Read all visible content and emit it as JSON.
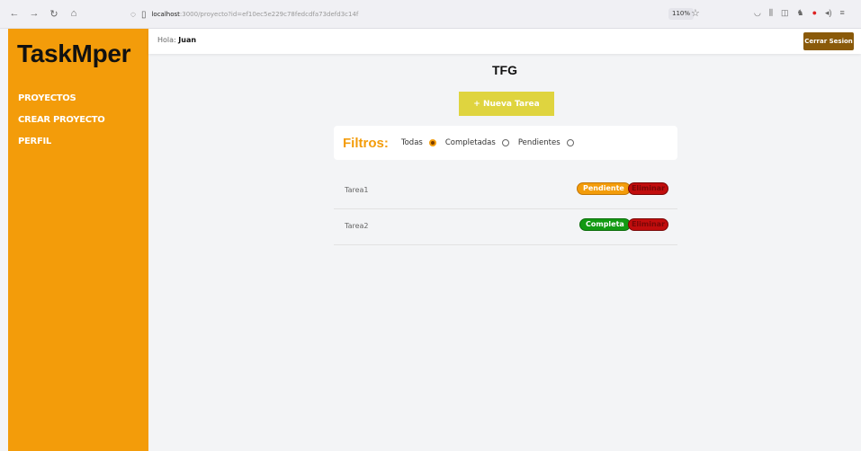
{
  "browser": {
    "url_host": "localhost",
    "url_rest": ":3000/proyecto?id=ef10ec5e229c78fedcdfa73defd3c14f",
    "zoom": "110%"
  },
  "app": {
    "brand": "TaskMper",
    "greeting_prefix": "Hola:",
    "user_name": "Juan",
    "logout_label": "Cerrar Sesion"
  },
  "sidebar": {
    "items": [
      {
        "label": "PROYECTOS"
      },
      {
        "label": "CREAR PROYECTO"
      },
      {
        "label": "PERFIL"
      }
    ]
  },
  "project": {
    "title": "TFG",
    "new_task_label": "+ Nueva Tarea"
  },
  "filters": {
    "title": "Filtros:",
    "options": [
      {
        "label": "Todas",
        "checked": true
      },
      {
        "label": "Completadas",
        "checked": false
      },
      {
        "label": "Pendientes",
        "checked": false
      }
    ]
  },
  "tasks": [
    {
      "name": "Tarea1",
      "state_label": "Pendiente",
      "delete_label": "Eliminar"
    },
    {
      "name": "Tarea2",
      "state_label": "Completa",
      "delete_label": "Eliminar"
    }
  ],
  "colors": {
    "accent": "#f39c0a",
    "new_task": "#dfd43f",
    "logout": "#8a5a0a",
    "complete": "#129a12",
    "delete": "#c10d0d"
  }
}
